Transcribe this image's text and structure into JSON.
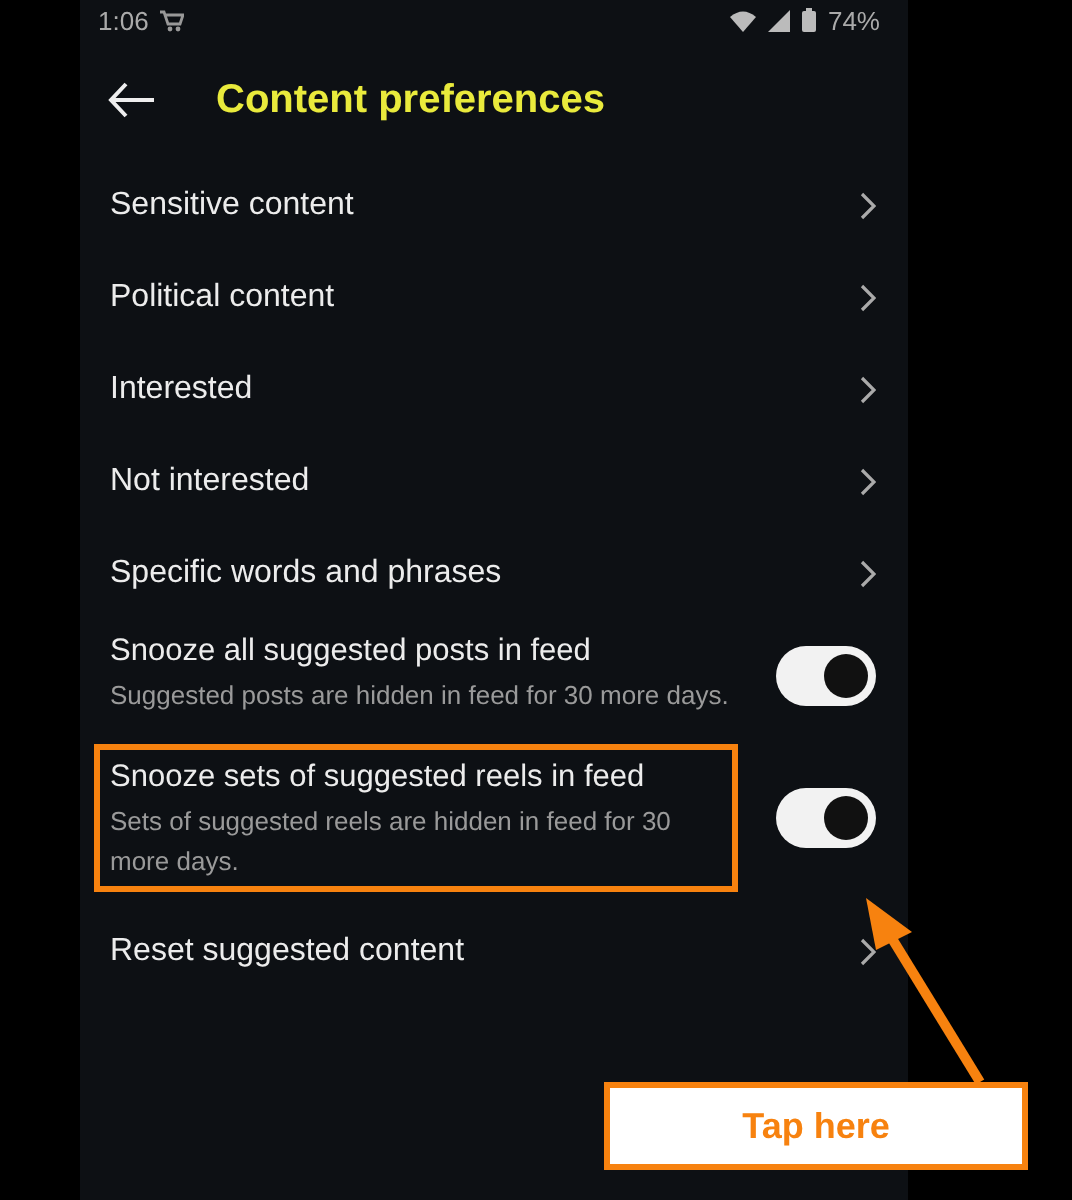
{
  "status_bar": {
    "time": "1:06",
    "battery": "74%"
  },
  "header": {
    "title": "Content preferences"
  },
  "rows": [
    {
      "kind": "link",
      "title": "Sensitive content"
    },
    {
      "kind": "link",
      "title": "Political content"
    },
    {
      "kind": "link",
      "title": "Interested"
    },
    {
      "kind": "link",
      "title": "Not interested"
    },
    {
      "kind": "link",
      "title": "Specific words and phrases"
    },
    {
      "kind": "toggle",
      "title": "Snooze all suggested posts in feed",
      "subtitle": "Suggested posts are hidden in feed for 30 more days.",
      "on": true,
      "highlighted": false
    },
    {
      "kind": "toggle",
      "title": "Snooze sets of suggested reels in feed",
      "subtitle": "Sets of suggested reels are hidden in feed for 30 more days.",
      "on": true,
      "highlighted": true
    },
    {
      "kind": "link",
      "title": "Reset suggested content"
    }
  ],
  "callout": {
    "text": "Tap here"
  }
}
